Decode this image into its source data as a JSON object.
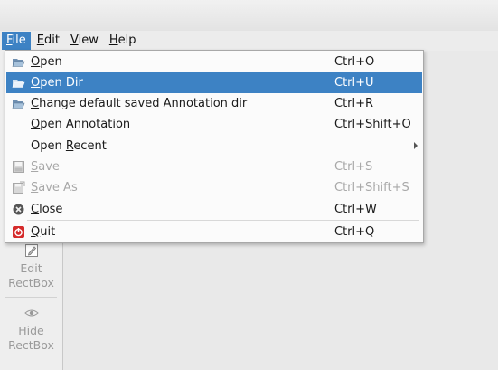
{
  "menubar": {
    "file": {
      "mnemonic": "F",
      "rest": "ile"
    },
    "edit": {
      "mnemonic": "E",
      "rest": "dit"
    },
    "view": {
      "mnemonic": "V",
      "rest": "iew"
    },
    "help": {
      "mnemonic": "H",
      "rest": "elp"
    }
  },
  "file_menu": {
    "items": [
      {
        "pre": "",
        "mn": "O",
        "post": "pen",
        "shortcut": "Ctrl+O",
        "icon": "folder-open-icon"
      },
      {
        "pre": "",
        "mn": "O",
        "post": "pen Dir",
        "shortcut": "Ctrl+U",
        "icon": "folder-open-icon"
      },
      {
        "pre": "",
        "mn": "C",
        "post": "hange default saved Annotation dir",
        "shortcut": "Ctrl+R",
        "icon": "folder-open-icon"
      },
      {
        "pre": "",
        "mn": "O",
        "post": "pen Annotation",
        "shortcut": "Ctrl+Shift+O",
        "icon": ""
      },
      {
        "pre": "Open ",
        "mn": "R",
        "post": "ecent",
        "shortcut": "",
        "icon": ""
      },
      {
        "pre": "",
        "mn": "S",
        "post": "ave",
        "shortcut": "Ctrl+S",
        "icon": "save-icon"
      },
      {
        "pre": "",
        "mn": "S",
        "post": "ave As",
        "shortcut": "Ctrl+Shift+S",
        "icon": "save-as-icon"
      },
      {
        "pre": "",
        "mn": "C",
        "post": "lose",
        "shortcut": "Ctrl+W",
        "icon": "close-icon"
      },
      {
        "pre": "",
        "mn": "Q",
        "post": "uit",
        "shortcut": "Ctrl+Q",
        "icon": "quit-icon"
      }
    ]
  },
  "toolbar": {
    "edit_rectbox": {
      "line1": "Edit",
      "line2": "RectBox",
      "icon": "edit-icon"
    },
    "hide_rectbox": {
      "line1": "Hide",
      "line2": "RectBox",
      "icon": "eye-icon"
    }
  },
  "colors": {
    "highlight": "#3d82c4",
    "disabled": "#a8a8a8"
  }
}
